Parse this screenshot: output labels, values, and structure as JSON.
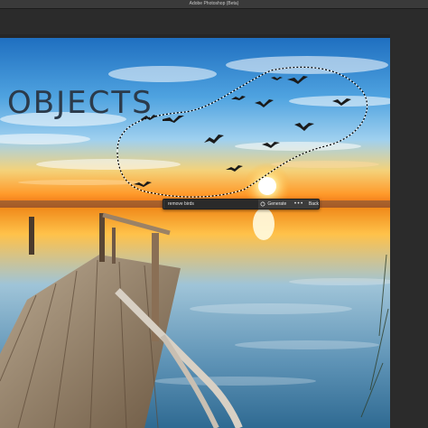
{
  "app": {
    "window_title": "Adobe Photoshop (Beta)"
  },
  "canvas": {
    "headline": "OBJECTS"
  },
  "contextual_taskbar": {
    "prompt_value": "remove birds",
    "generate_label": "Generate",
    "more_label": "•••",
    "back_label": "Back"
  },
  "icons": [
    "generate-icon",
    "more-icon"
  ]
}
